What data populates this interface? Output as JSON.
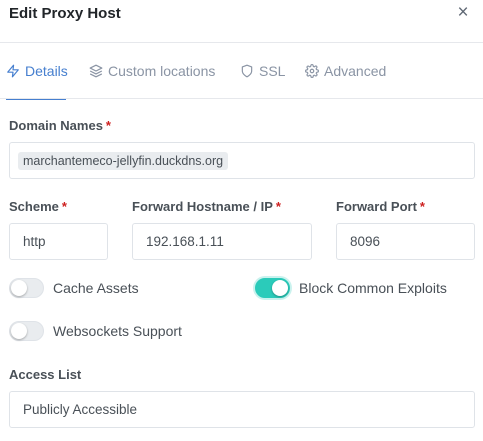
{
  "header": {
    "title": "Edit Proxy Host",
    "close_glyph": "×"
  },
  "tabs": [
    {
      "label": "Details",
      "icon": "bolt-icon",
      "active": true
    },
    {
      "label": "Custom locations",
      "icon": "layers-icon",
      "active": false
    },
    {
      "label": "SSL",
      "icon": "shield-icon",
      "active": false
    },
    {
      "label": "Advanced",
      "icon": "gear-icon",
      "active": false
    }
  ],
  "form": {
    "domain_names": {
      "label": "Domain Names",
      "required_mark": "*",
      "values": [
        "marchantemeco-jellyfin.duckdns.org"
      ]
    },
    "scheme": {
      "label": "Scheme",
      "required_mark": "*",
      "value": "http"
    },
    "forward_hostname": {
      "label": "Forward Hostname / IP",
      "required_mark": "*",
      "value": "192.168.1.11"
    },
    "forward_port": {
      "label": "Forward Port",
      "required_mark": "*",
      "value": "8096"
    },
    "toggles": [
      {
        "label": "Cache Assets",
        "on": false
      },
      {
        "label": "Block Common Exploits",
        "on": true
      },
      {
        "label": "Websockets Support",
        "on": false
      }
    ],
    "access_list": {
      "label": "Access List",
      "value": "Publicly Accessible"
    }
  },
  "colors": {
    "accent": "#467fcf",
    "toggle_on": "#2bcbba",
    "required": "#cd201f"
  }
}
